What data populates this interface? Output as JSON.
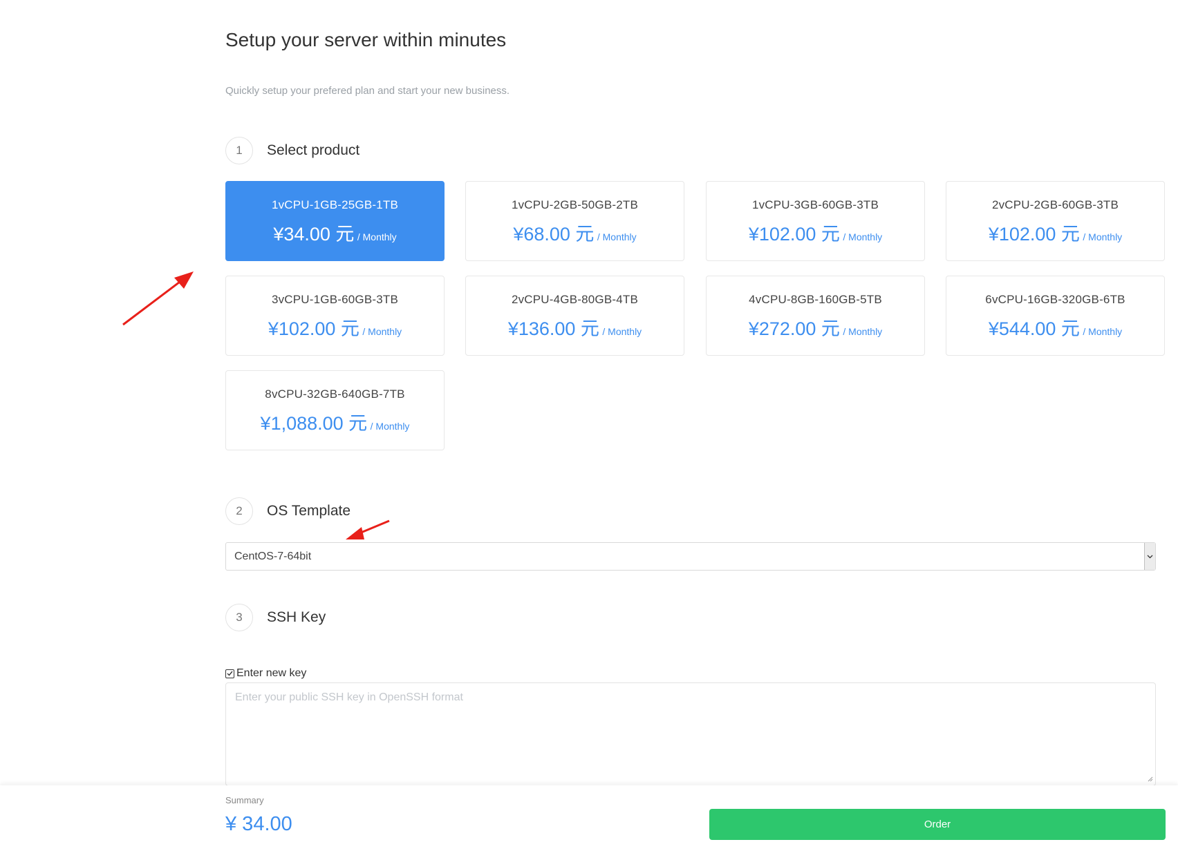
{
  "header": {
    "title": "Setup your server within minutes",
    "subtitle": "Quickly setup your prefered plan and start your new business."
  },
  "steps": [
    {
      "number": "1",
      "label": "Select product"
    },
    {
      "number": "2",
      "label": "OS Template"
    },
    {
      "number": "3",
      "label": "SSH Key"
    }
  ],
  "products": [
    {
      "name": "1vCPU-1GB-25GB-1TB",
      "price": "¥34.00 元",
      "period": "/ Monthly",
      "selected": true
    },
    {
      "name": "1vCPU-2GB-50GB-2TB",
      "price": "¥68.00 元",
      "period": "/ Monthly",
      "selected": false
    },
    {
      "name": "1vCPU-3GB-60GB-3TB",
      "price": "¥102.00 元",
      "period": "/ Monthly",
      "selected": false
    },
    {
      "name": "2vCPU-2GB-60GB-3TB",
      "price": "¥102.00 元",
      "period": "/ Monthly",
      "selected": false
    },
    {
      "name": "3vCPU-1GB-60GB-3TB",
      "price": "¥102.00 元",
      "period": "/ Monthly",
      "selected": false
    },
    {
      "name": "2vCPU-4GB-80GB-4TB",
      "price": "¥136.00 元",
      "period": "/ Monthly",
      "selected": false
    },
    {
      "name": "4vCPU-8GB-160GB-5TB",
      "price": "¥272.00 元",
      "period": "/ Monthly",
      "selected": false
    },
    {
      "name": "6vCPU-16GB-320GB-6TB",
      "price": "¥544.00 元",
      "period": "/ Monthly",
      "selected": false
    },
    {
      "name": "8vCPU-32GB-640GB-7TB",
      "price": "¥1,088.00 元",
      "period": "/ Monthly",
      "selected": false
    }
  ],
  "os_template": {
    "selected": "CentOS-7-64bit"
  },
  "ssh": {
    "checkbox_label": "Enter new key",
    "checked": true,
    "placeholder": "Enter your public SSH key in OpenSSH format"
  },
  "summary": {
    "label": "Summary",
    "value": "¥ 34.00"
  },
  "order_button": "Order",
  "colors": {
    "accent": "#3d8eef",
    "order": "#2dc76d",
    "annotation_arrow": "#e8201a"
  },
  "icons": {
    "checkbox": "check-icon",
    "select": "chevron-down-icon",
    "textarea": "resize-grip-icon"
  }
}
